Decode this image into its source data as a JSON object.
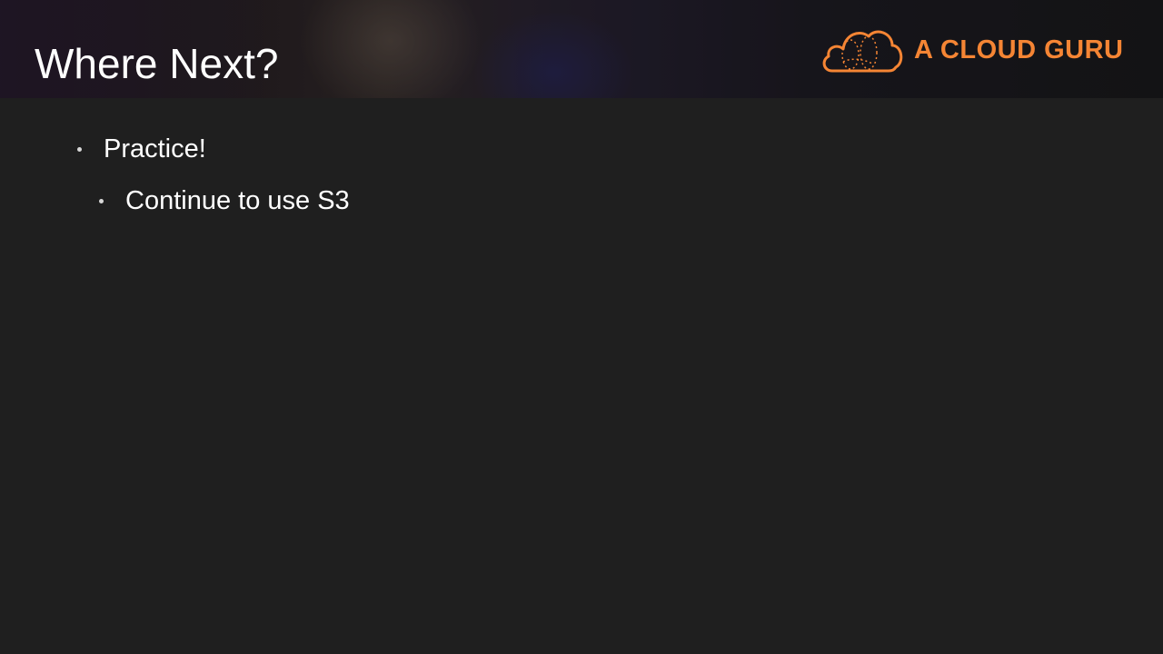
{
  "slide": {
    "title": "Where Next?",
    "logo": {
      "text": "A CLOUD GURU",
      "icon": "cloud-icon",
      "color": "#f58534"
    },
    "bullets": [
      {
        "level": 1,
        "text": "Practice!"
      },
      {
        "level": 2,
        "text": "Continue to use S3"
      }
    ]
  }
}
